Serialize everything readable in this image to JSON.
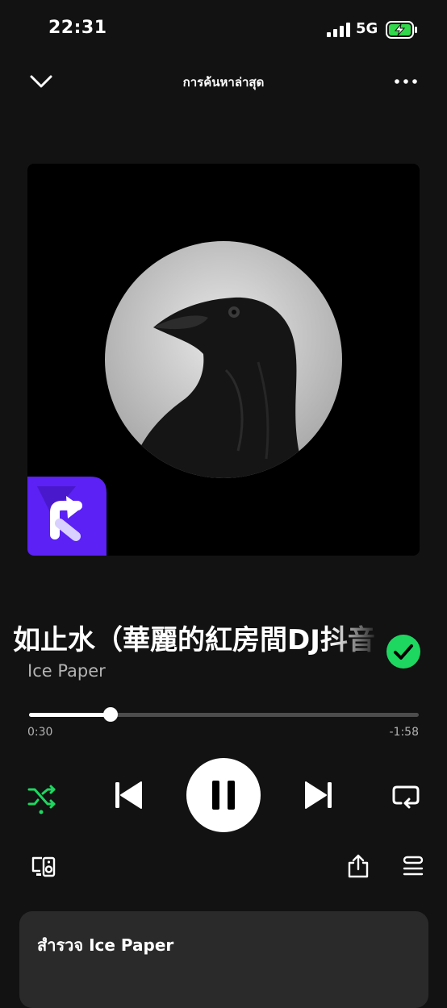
{
  "status_bar": {
    "time": "22:31",
    "network": "5G",
    "icons": [
      "signal-icon",
      "battery-charging-icon"
    ]
  },
  "header": {
    "title": "การค้นหาล่าสุด",
    "icons": [
      "chevron-down-icon",
      "more-icon"
    ]
  },
  "artwork": {
    "description_icons": [
      "raven-image",
      "badge-logo"
    ],
    "badge_color": "#5b21f5"
  },
  "track": {
    "title": "如止水（華麗的紅房間DJ抖音",
    "artist": "Ice Paper",
    "liked": true
  },
  "progress": {
    "elapsed": "0:30",
    "remaining": "-1:58",
    "fraction": 0.21
  },
  "controls": {
    "shuffle_active": true,
    "icons": [
      "shuffle-icon",
      "previous-icon",
      "pause-icon",
      "next-icon",
      "repeat-icon"
    ]
  },
  "bottom_bar": {
    "icons": [
      "devices-icon",
      "share-icon",
      "queue-icon"
    ]
  },
  "explore_card": {
    "title": "สำรวจ Ice Paper"
  },
  "colors": {
    "background": "#121212",
    "accent": "#1ed760",
    "muted_text": "#b3b3b3"
  }
}
